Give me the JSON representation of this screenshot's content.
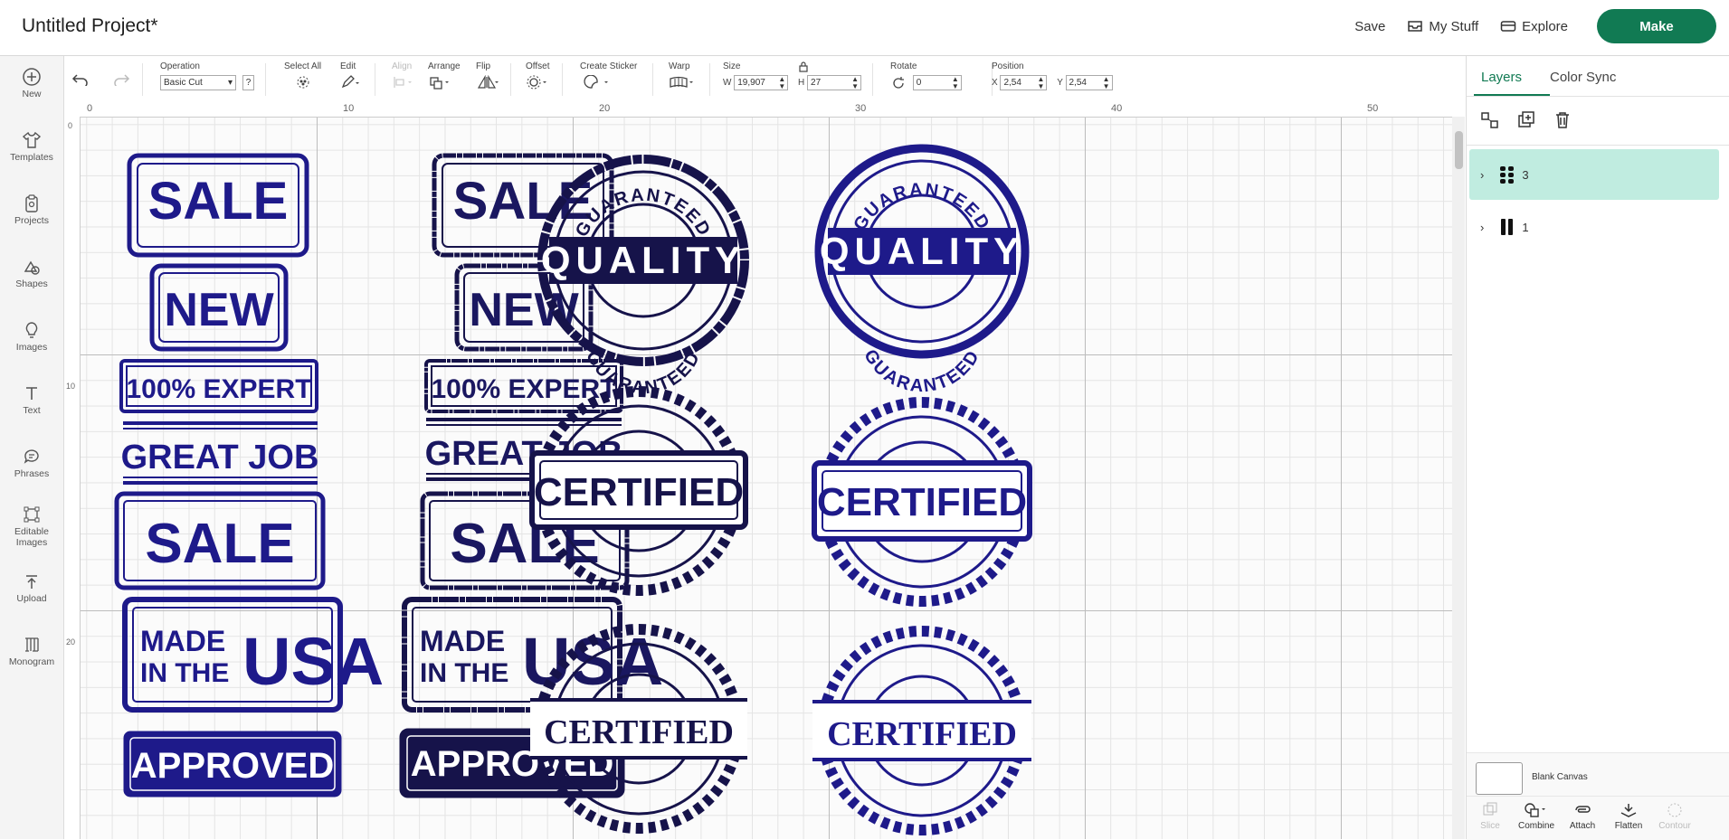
{
  "header": {
    "title": "Untitled Project*",
    "save_label": "Save",
    "mystuff_label": "My Stuff",
    "explore_label": "Explore",
    "make_label": "Make"
  },
  "sidebar": {
    "items": [
      {
        "label": "New",
        "icon": "plus-circle-icon"
      },
      {
        "label": "Templates",
        "icon": "shirt-icon"
      },
      {
        "label": "Projects",
        "icon": "clipboard-icon"
      },
      {
        "label": "Shapes",
        "icon": "shapes-icon"
      },
      {
        "label": "Images",
        "icon": "lightbulb-icon"
      },
      {
        "label": "Text",
        "icon": "text-icon"
      },
      {
        "label": "Phrases",
        "icon": "speech-bubble-icon"
      },
      {
        "label": "Editable Images",
        "icon": "editable-image-icon"
      },
      {
        "label": "Upload",
        "icon": "upload-icon"
      },
      {
        "label": "Monogram",
        "icon": "monogram-icon"
      }
    ]
  },
  "toolbar": {
    "operation_label": "Operation",
    "operation_value": "Basic Cut",
    "help": "?",
    "select_all_label": "Select All",
    "edit_label": "Edit",
    "align_label": "Align",
    "arrange_label": "Arrange",
    "flip_label": "Flip",
    "offset_label": "Offset",
    "create_sticker_label": "Create Sticker",
    "warp_label": "Warp",
    "size_label": "Size",
    "w_label": "W",
    "w_value": "19,907",
    "h_label": "H",
    "h_value": "27",
    "rotate_label": "Rotate",
    "rotate_value": "0",
    "position_label": "Position",
    "x_label": "X",
    "x_value": "2,54",
    "y_label": "Y",
    "y_value": "2,54"
  },
  "rulers": {
    "top": [
      "0",
      "10",
      "20",
      "30",
      "40",
      "50"
    ],
    "left": [
      "0",
      "10",
      "20"
    ]
  },
  "canvas": {
    "stamp_color": "#1e1a8a",
    "stamps": {
      "sale": "SALE",
      "new": "NEW",
      "expert": "100% EXPERT",
      "great_job": "GREAT JOB",
      "made_in": "MADE",
      "in_the": "IN THE",
      "usa": "USA",
      "approved": "APPROVED",
      "quality": "QUALITY",
      "guaranteed": "GUARANTEED",
      "certified": "CERTIFIED"
    }
  },
  "panel": {
    "tab_layers": "Layers",
    "tab_color_sync": "Color Sync",
    "layers": [
      {
        "count": "3",
        "selected": true
      },
      {
        "count": "1",
        "selected": false
      }
    ],
    "blank_canvas_label": "Blank Canvas",
    "bottom_tools": [
      {
        "label": "Slice",
        "enabled": false
      },
      {
        "label": "Combine",
        "enabled": true
      },
      {
        "label": "Attach",
        "enabled": true
      },
      {
        "label": "Flatten",
        "enabled": true
      },
      {
        "label": "Contour",
        "enabled": false
      }
    ]
  },
  "colors": {
    "accent": "#117a53",
    "stamp_blue": "#1e1a8a",
    "selected_layer": "#c0ece0"
  }
}
